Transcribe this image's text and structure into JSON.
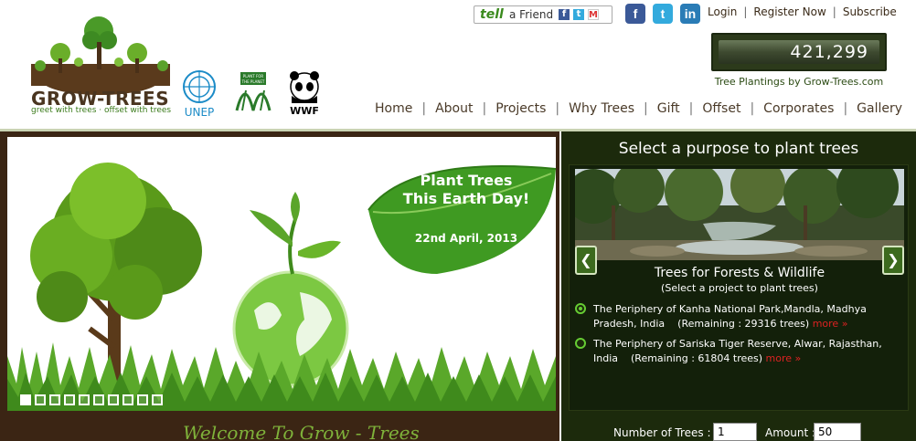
{
  "brand": {
    "name": "GROW-TREES",
    "domain_suffix": ".com",
    "tagline": "greet with trees · offset with trees",
    "partners": [
      "UNEP",
      "PLANT FOR THE PLANET",
      "WWF"
    ]
  },
  "tell_friend": {
    "prefix": "tell",
    "label": "a Friend",
    "icons": [
      "facebook-icon",
      "twitter-icon",
      "gmail-icon"
    ]
  },
  "social": {
    "icons": [
      "facebook-icon",
      "twitter-icon",
      "linkedin-icon"
    ]
  },
  "top_links": [
    "Login",
    "Register Now",
    "Subscribe"
  ],
  "counter": {
    "value": "421,299",
    "label": "Tree Plantings by Grow-Trees.com"
  },
  "nav": [
    "Home",
    "About",
    "Projects",
    "Why Trees",
    "Gift",
    "Offset",
    "Corporates",
    "Gallery"
  ],
  "banner": {
    "headline_line1": "Plant Trees",
    "headline_line2": "This Earth Day!",
    "date": "22nd April, 2013",
    "slide_count": 10,
    "active_slide": 0
  },
  "welcome_text": "Welcome To Grow - Trees",
  "panel": {
    "title": "Select a purpose to plant trees",
    "category_title": "Trees for Forests & Wildlife",
    "category_subtitle": "(Select a project to plant trees)",
    "projects": [
      {
        "text": "The Periphery of Kanha National Park,Mandla, Madhya Pradesh, India",
        "remaining": "(Remaining : 29316 trees)",
        "more": "more »",
        "selected": true
      },
      {
        "text": "The Periphery of Sariska Tiger Reserve, Alwar, Rajasthan, India",
        "remaining": "(Remaining : 61804 trees)",
        "more": "more »",
        "selected": false
      }
    ],
    "form": {
      "trees_label": "Number of Trees :",
      "trees_value": "1",
      "amount_label": "Amount :",
      "amount_value": "50"
    }
  },
  "colors": {
    "brand_green": "#3a8a1d",
    "panel_bg": "#1c2a0c",
    "banner_frame": "#3b2514",
    "more_red": "#dd2222"
  }
}
